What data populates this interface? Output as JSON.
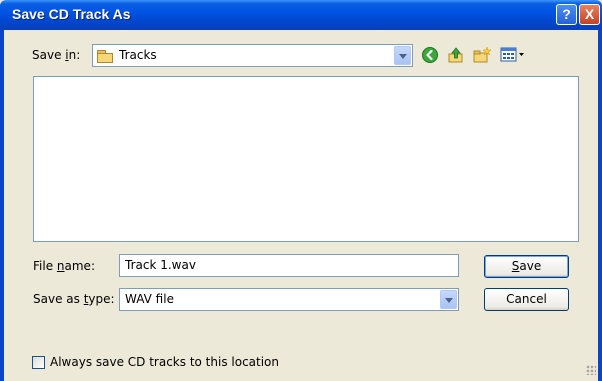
{
  "window": {
    "title": "Save CD Track As",
    "help_label": "?",
    "close_label": "X"
  },
  "save_in": {
    "label_prefix": "Save ",
    "label_accel": "i",
    "label_suffix": "n:",
    "value": "Tracks",
    "toolbar_icons": [
      "back-icon",
      "up-folder-icon",
      "new-folder-icon",
      "view-menu-icon"
    ]
  },
  "file_name": {
    "label_prefix": "File ",
    "label_accel": "n",
    "label_suffix": "ame:",
    "value": "Track 1.wav"
  },
  "save_as_type": {
    "label_prefix": "Save as ",
    "label_accel": "t",
    "label_suffix": "ype:",
    "value": "WAV file"
  },
  "buttons": {
    "save_accel": "S",
    "save_rest": "ave",
    "cancel": "Cancel"
  },
  "checkbox": {
    "label": "Always save CD tracks to this location",
    "checked": false
  },
  "colors": {
    "title_bar": "#0054e3",
    "dialog_bg": "#ece9d8",
    "field_border": "#7f9db9"
  }
}
